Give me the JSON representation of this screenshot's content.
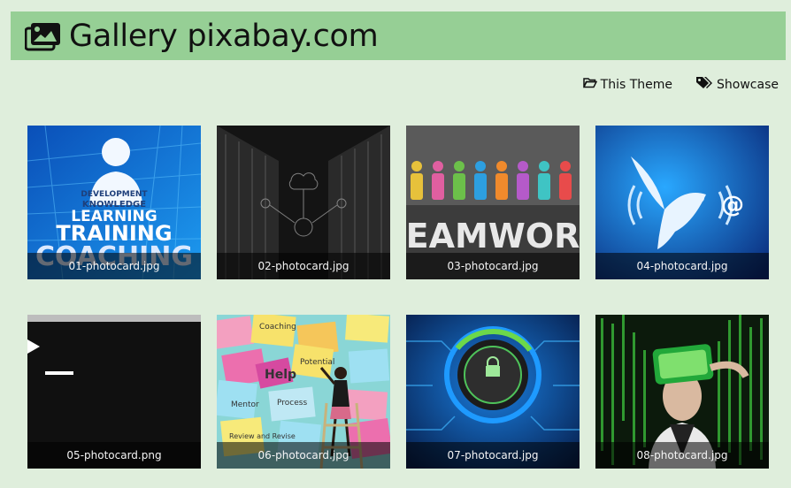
{
  "header": {
    "title": "Gallery pixabay.com",
    "icon": "images-icon"
  },
  "nav": {
    "theme_label": "This Theme",
    "theme_icon": "folder-open-icon",
    "showcase_label": "Showcase",
    "showcase_icon": "tags-icon"
  },
  "gallery": {
    "items": [
      {
        "caption": "01-photocard.jpg",
        "art_text": [
          "DEVELOPMENT",
          "KNOWLEDGE",
          "LEARNING",
          "TRAINING",
          "COACHING"
        ]
      },
      {
        "caption": "02-photocard.jpg"
      },
      {
        "caption": "03-photocard.jpg",
        "art_text": [
          "EAMWOR"
        ]
      },
      {
        "caption": "04-photocard.jpg",
        "art_text": [
          "@"
        ]
      },
      {
        "caption": "05-photocard.png"
      },
      {
        "caption": "06-photocard.jpg",
        "art_text": [
          "Coaching",
          "Help",
          "Potential",
          "Mentor",
          "Process",
          "Review and Revise"
        ]
      },
      {
        "caption": "07-photocard.jpg"
      },
      {
        "caption": "08-photocard.jpg"
      }
    ]
  },
  "colors": {
    "page_bg": "#dfeedc",
    "header_bg": "#96cf95"
  }
}
